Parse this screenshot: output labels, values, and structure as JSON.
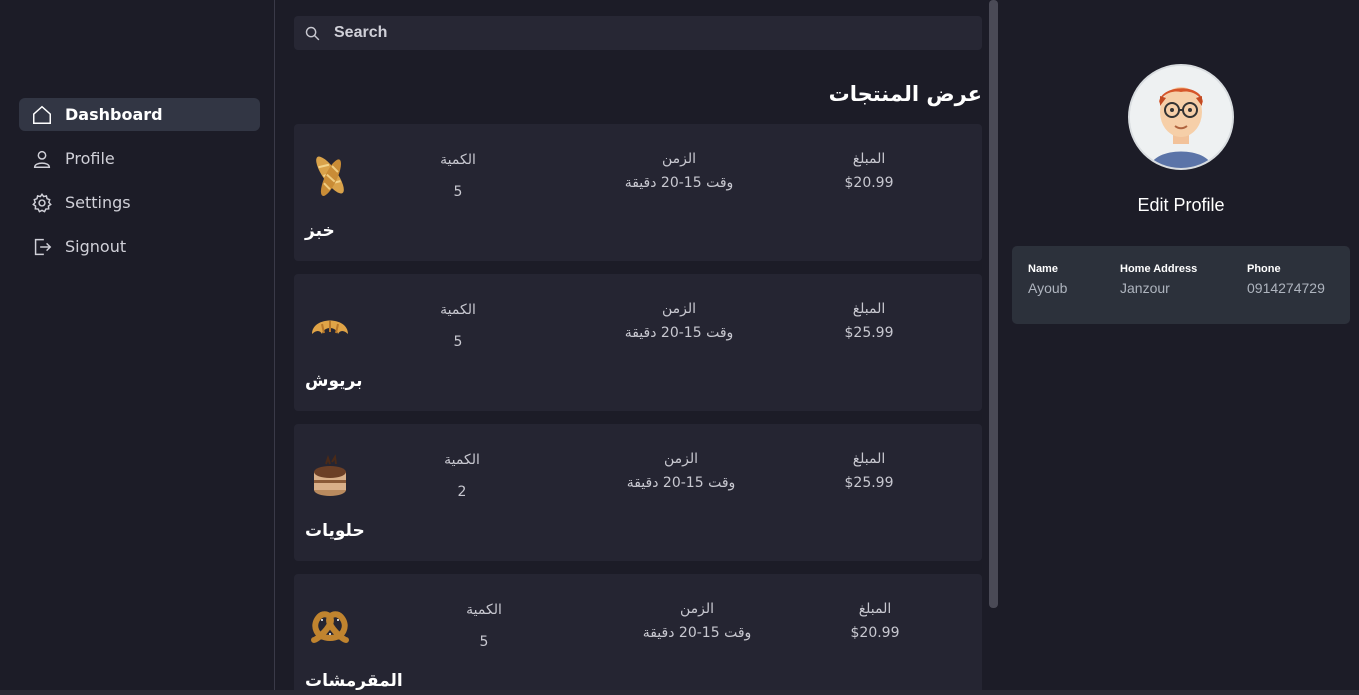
{
  "sidebar": {
    "items": [
      {
        "label": "Dashboard",
        "icon": "home-icon",
        "active": true
      },
      {
        "label": "Profile",
        "icon": "user-icon",
        "active": false
      },
      {
        "label": "Settings",
        "icon": "gear-icon",
        "active": false
      },
      {
        "label": "Signout",
        "icon": "signout-icon",
        "active": false
      }
    ]
  },
  "search": {
    "placeholder": "Search"
  },
  "main": {
    "title": "عرض المنتجات",
    "products": [
      {
        "name": "خبز",
        "image": "baguette-icon",
        "qty_label": "الكمية",
        "qty": "5",
        "time_label": "الزمن",
        "time": "وقت 15-20 دقيقة",
        "price_label": "المبلغ",
        "price": "$20.99"
      },
      {
        "name": "بريوش",
        "image": "croissant-icon",
        "qty_label": "الكمية",
        "qty": "5",
        "time_label": "الزمن",
        "time": "وقت 15-20 دقيقة",
        "price_label": "المبلغ",
        "price": "$25.99"
      },
      {
        "name": "حلويات",
        "image": "cake-icon",
        "qty_label": "الكمية",
        "qty": "2",
        "time_label": "الزمن",
        "time": "وقت 15-20 دقيقة",
        "price_label": "المبلغ",
        "price": "$25.99"
      },
      {
        "name": "المقرمشات",
        "image": "pretzel-icon",
        "qty_label": "الكمية",
        "qty": "5",
        "time_label": "الزمن",
        "time": "وقت 15-20 دقيقة",
        "price_label": "المبلغ",
        "price": "$20.99"
      }
    ]
  },
  "profile": {
    "edit_label": "Edit Profile",
    "name_label": "Name",
    "name": "Ayoub",
    "address_label": "Home Address",
    "address": "Janzour",
    "phone_label": "Phone",
    "phone": "0914274729"
  },
  "colors": {
    "background": "#1c1c27",
    "card": "#252532",
    "active_nav": "#323644",
    "info_card": "#2c313b"
  }
}
